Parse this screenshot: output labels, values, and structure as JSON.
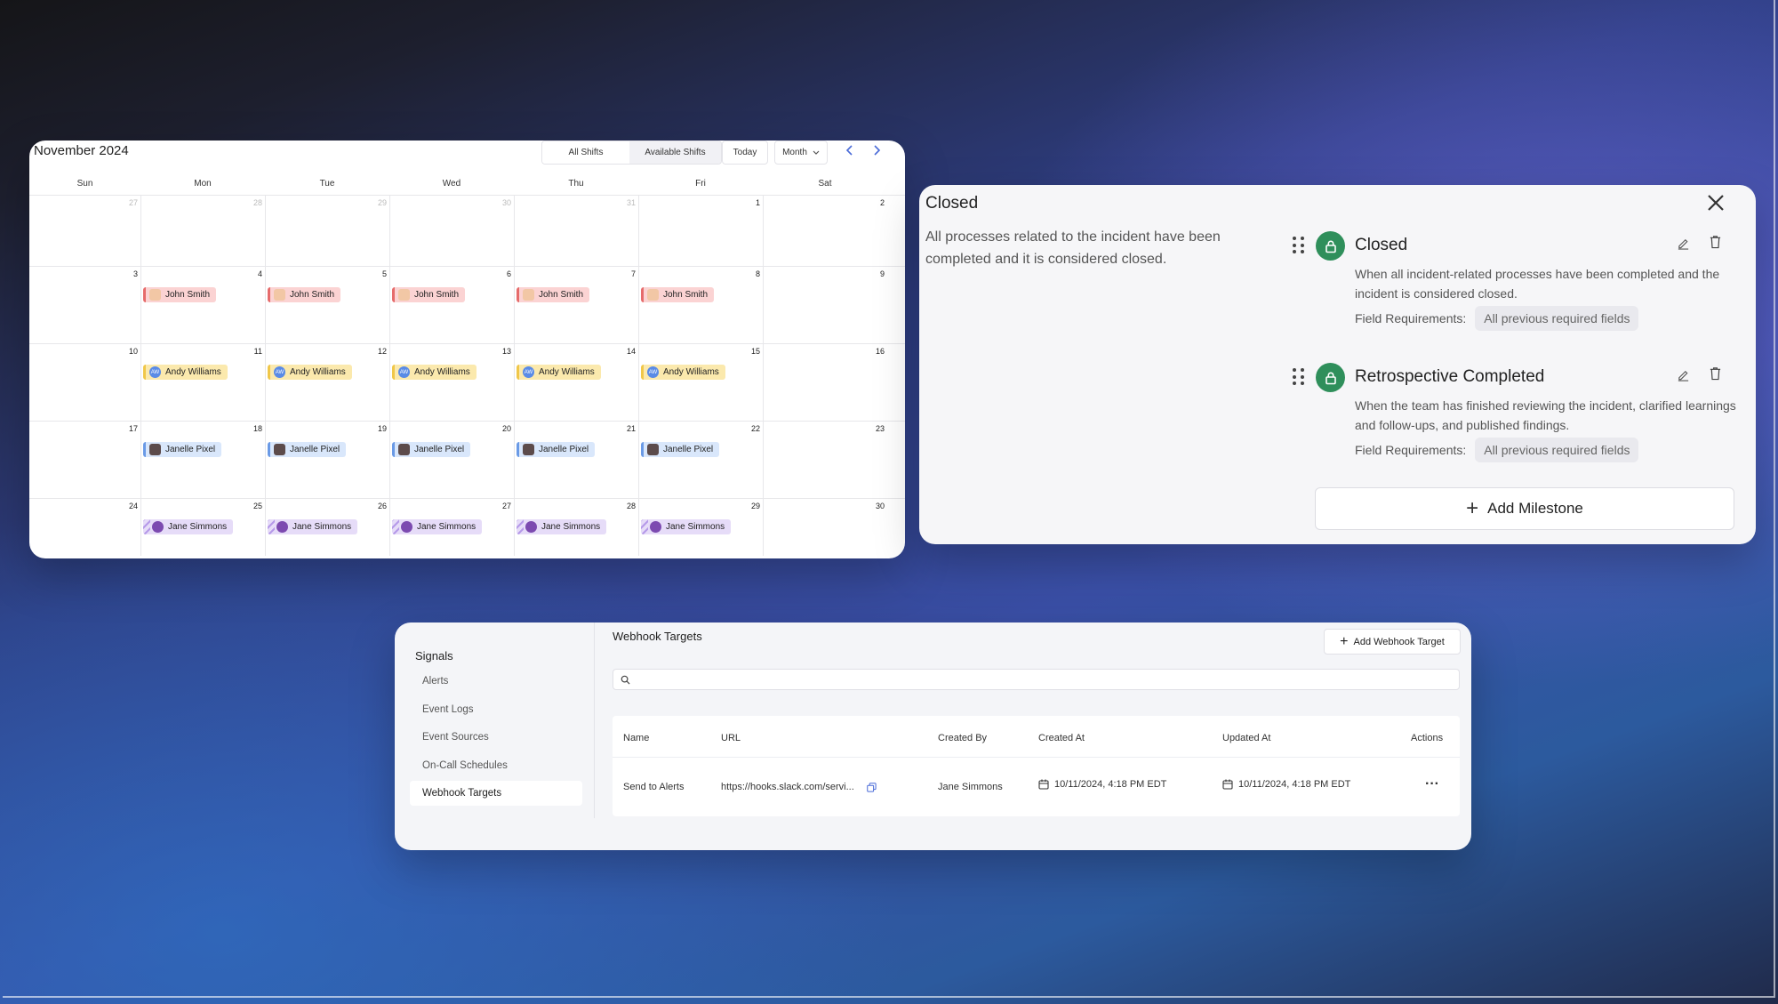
{
  "calendar": {
    "title": "November 2024",
    "tabs": [
      "All Shifts",
      "Available Shifts"
    ],
    "today_label": "Today",
    "view_label": "Month",
    "weekdays": [
      "Sun",
      "Mon",
      "Tue",
      "Wed",
      "Thu",
      "Fri",
      "Sat"
    ],
    "weeks": [
      {
        "days": [
          {
            "d": "27",
            "muted": true
          },
          {
            "d": "28",
            "muted": true
          },
          {
            "d": "29",
            "muted": true
          },
          {
            "d": "30",
            "muted": true
          },
          {
            "d": "31",
            "muted": true
          },
          {
            "d": "1"
          },
          {
            "d": "2"
          }
        ],
        "shift": null
      },
      {
        "days": [
          {
            "d": "3"
          },
          {
            "d": "4"
          },
          {
            "d": "5"
          },
          {
            "d": "6"
          },
          {
            "d": "7"
          },
          {
            "d": "8"
          },
          {
            "d": "9"
          }
        ],
        "shift": {
          "name": "John Smith",
          "style": "john",
          "initials": ""
        }
      },
      {
        "days": [
          {
            "d": "10"
          },
          {
            "d": "11"
          },
          {
            "d": "12"
          },
          {
            "d": "13"
          },
          {
            "d": "14"
          },
          {
            "d": "15"
          },
          {
            "d": "16"
          }
        ],
        "shift": {
          "name": "Andy Williams",
          "style": "andy",
          "initials": "AW"
        }
      },
      {
        "days": [
          {
            "d": "17"
          },
          {
            "d": "18"
          },
          {
            "d": "19"
          },
          {
            "d": "20"
          },
          {
            "d": "21"
          },
          {
            "d": "22"
          },
          {
            "d": "23"
          }
        ],
        "shift": {
          "name": "Janelle Pixel",
          "style": "janelle",
          "initials": ""
        }
      },
      {
        "days": [
          {
            "d": "24"
          },
          {
            "d": "25"
          },
          {
            "d": "26"
          },
          {
            "d": "27"
          },
          {
            "d": "28"
          },
          {
            "d": "29"
          },
          {
            "d": "30"
          }
        ],
        "shift": {
          "name": "Jane Simmons",
          "style": "jane",
          "initials": ""
        }
      }
    ]
  },
  "milestone_panel": {
    "title": "Closed",
    "description": "All processes related to the incident have been completed and it is considered closed.",
    "items": [
      {
        "name": "Closed",
        "text": "When all incident-related processes have been completed and the incident is considered closed.",
        "req_label": "Field Requirements:",
        "req_value": "All previous required fields"
      },
      {
        "name": "Retrospective Completed",
        "text": "When the team has finished reviewing the incident, clarified learnings and follow-ups, and published findings.",
        "req_label": "Field Requirements:",
        "req_value": "All previous required fields"
      }
    ],
    "add_label": "Add Milestone"
  },
  "webhooks": {
    "sidebar_title": "Signals",
    "sidebar_items": [
      "Alerts",
      "Event Logs",
      "Event Sources",
      "On-Call Schedules",
      "Webhook Targets"
    ],
    "active_item": "Webhook Targets",
    "title": "Webhook Targets",
    "add_label": "Add Webhook Target",
    "search_placeholder": "",
    "columns": [
      "Name",
      "URL",
      "Created By",
      "Created At",
      "Updated At",
      "Actions"
    ],
    "rows": [
      {
        "name": "Send to Alerts",
        "url": "https://hooks.slack.com/servi...",
        "created_by": "Jane Simmons",
        "created_at": "10/11/2024, 4:18 PM EDT",
        "updated_at": "10/11/2024, 4:18 PM EDT",
        "actions": "···"
      }
    ]
  }
}
